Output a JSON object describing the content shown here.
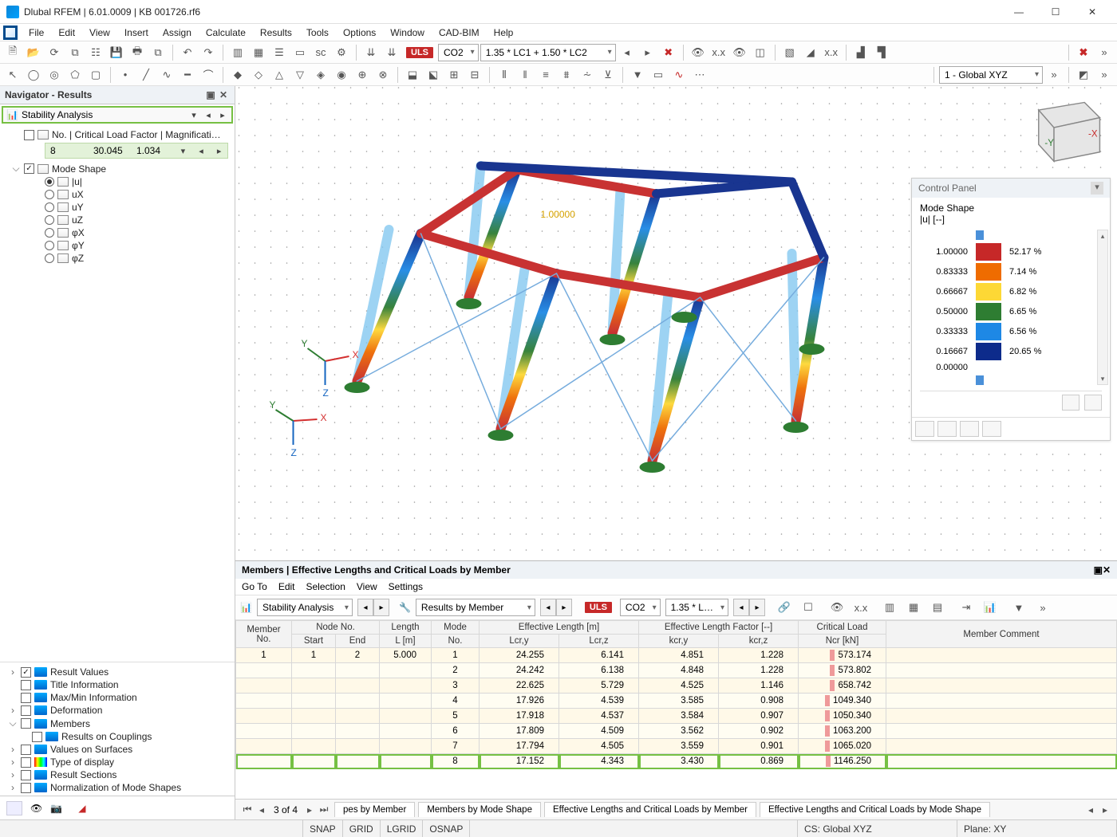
{
  "title": "Dlubal RFEM | 6.01.0009 | KB 001726.rf6",
  "menu": [
    "File",
    "Edit",
    "View",
    "Insert",
    "Assign",
    "Calculate",
    "Results",
    "Tools",
    "Options",
    "Window",
    "CAD-BIM",
    "Help"
  ],
  "toolbar1": {
    "uls": "ULS",
    "combo_co": "CO2",
    "combo_expr": "1.35 * LC1 + 1.50 * LC2",
    "global": "1 - Global XYZ"
  },
  "navigator": {
    "title": "Navigator - Results",
    "dropdown": "Stability Analysis",
    "first_header": "No. | Critical Load Factor | Magnificati…",
    "first_values": {
      "no": "8",
      "factor": "30.045",
      "mag": "1.034"
    },
    "mode_shape": "Mode Shape",
    "mode_items": [
      "|u|",
      "uX",
      "uY",
      "uZ",
      "φX",
      "φY",
      "φZ"
    ],
    "bottom": [
      "Result Values",
      "Title Information",
      "Max/Min Information",
      "Deformation",
      "Members",
      "Results on Couplings",
      "Values on Surfaces",
      "Type of display",
      "Result Sections",
      "Normalization of Mode Shapes"
    ]
  },
  "control_panel": {
    "title": "Control Panel",
    "head1": "Mode Shape",
    "head2": "|u| [--]",
    "rows": [
      {
        "val": "1.00000",
        "color": "#c62828",
        "pct": "52.17 %"
      },
      {
        "val": "0.83333",
        "color": "#ef6c00",
        "pct": "7.14 %"
      },
      {
        "val": "0.66667",
        "color": "#fdd835",
        "pct": "6.82 %"
      },
      {
        "val": "0.50000",
        "color": "#2e7d32",
        "pct": "6.65 %"
      },
      {
        "val": "0.33333",
        "color": "#1e88e5",
        "pct": "6.56 %"
      },
      {
        "val": "0.16667",
        "color": "#0d2b8b",
        "pct": "20.65 %"
      },
      {
        "val": "0.00000",
        "color": "",
        "pct": ""
      }
    ]
  },
  "table_panel": {
    "title": "Members | Effective Lengths and Critical Loads by Member",
    "menu": [
      "Go To",
      "Edit",
      "Selection",
      "View",
      "Settings"
    ],
    "combo1": "Stability Analysis",
    "combo2": "Results by Member",
    "uls": "ULS",
    "co": "CO2",
    "expr": "1.35 * L…",
    "cols_top": [
      "Member",
      "Node No.",
      "Length",
      "Mode",
      "Effective Length [m]",
      "Effective Length Factor [--]",
      "Critical Load",
      ""
    ],
    "cols_bot": [
      "No.",
      "Start",
      "End",
      "L [m]",
      "No.",
      "Lcr,y",
      "Lcr,z",
      "kcr,y",
      "kcr,z",
      "Ncr [kN]",
      "Member Comment"
    ],
    "rows": [
      {
        "m": "1",
        "s": "1",
        "e": "2",
        "L": "5.000",
        "mode": "1",
        "ly": "24.255",
        "lz": "6.141",
        "ky": "4.851",
        "kz": "1.228",
        "n": "573.174"
      },
      {
        "m": "",
        "s": "",
        "e": "",
        "L": "",
        "mode": "2",
        "ly": "24.242",
        "lz": "6.138",
        "ky": "4.848",
        "kz": "1.228",
        "n": "573.802"
      },
      {
        "m": "",
        "s": "",
        "e": "",
        "L": "",
        "mode": "3",
        "ly": "22.625",
        "lz": "5.729",
        "ky": "4.525",
        "kz": "1.146",
        "n": "658.742"
      },
      {
        "m": "",
        "s": "",
        "e": "",
        "L": "",
        "mode": "4",
        "ly": "17.926",
        "lz": "4.539",
        "ky": "3.585",
        "kz": "0.908",
        "n": "1049.340"
      },
      {
        "m": "",
        "s": "",
        "e": "",
        "L": "",
        "mode": "5",
        "ly": "17.918",
        "lz": "4.537",
        "ky": "3.584",
        "kz": "0.907",
        "n": "1050.340"
      },
      {
        "m": "",
        "s": "",
        "e": "",
        "L": "",
        "mode": "6",
        "ly": "17.809",
        "lz": "4.509",
        "ky": "3.562",
        "kz": "0.902",
        "n": "1063.200"
      },
      {
        "m": "",
        "s": "",
        "e": "",
        "L": "",
        "mode": "7",
        "ly": "17.794",
        "lz": "4.505",
        "ky": "3.559",
        "kz": "0.901",
        "n": "1065.020"
      },
      {
        "m": "",
        "s": "",
        "e": "",
        "L": "",
        "mode": "8",
        "ly": "17.152",
        "lz": "4.343",
        "ky": "3.430",
        "kz": "0.869",
        "n": "1146.250"
      }
    ],
    "page": "3 of 4",
    "tabs": [
      "pes by Member",
      "Members by Mode Shape",
      "Effective Lengths and Critical Loads by Member",
      "Effective Lengths and Critical Loads by Mode Shape"
    ]
  },
  "status": {
    "snap": "SNAP",
    "grid": "GRID",
    "lgrid": "LGRID",
    "osnap": "OSNAP",
    "cs": "CS: Global XYZ",
    "plane": "Plane: XY"
  },
  "axes": {
    "x": "X",
    "y": "Y",
    "z": "Z"
  },
  "vp_label": "1.00000"
}
